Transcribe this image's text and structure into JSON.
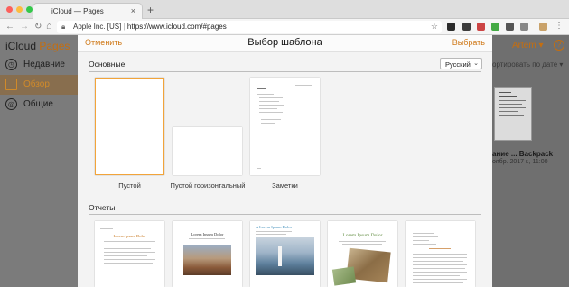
{
  "browser": {
    "tab_title": "iCloud — Pages",
    "tab_close": "×",
    "new_tab": "+",
    "url_site": "Apple Inc. [US]",
    "url_sep": "|",
    "url_text": "https://www.icloud.com/#pages"
  },
  "app": {
    "logo_prefix": "iCloud",
    "logo_app": "Pages",
    "nav": [
      {
        "label": "Недавние",
        "icon": "clock-icon"
      },
      {
        "label": "Обзор",
        "icon": "folder-icon",
        "selected": true
      },
      {
        "label": "Общие",
        "icon": "people-icon"
      }
    ],
    "user": "Artem ▾",
    "help": "?",
    "sort_label": "ортировать по дате ▾",
    "doc_name": "ание ... Backpack",
    "doc_date": "оябр. 2017 г., 11:00"
  },
  "modal": {
    "cancel": "Отменить",
    "title": "Выбор шаблона",
    "choose": "Выбрать",
    "language": "Русский",
    "sections": [
      {
        "title": "Основные",
        "templates": [
          "Пустой",
          "Пустой горизонтальный",
          "Заметки"
        ]
      },
      {
        "title": "Отчеты",
        "templates": [
          "",
          "",
          "",
          "",
          ""
        ]
      }
    ],
    "report_headlines": [
      "Lorem Ipsum Dolor",
      "Lorem Ipsum Dolor",
      "A Lorem Ipsum Dolor",
      "Lorem Ipsum Dolor",
      ""
    ]
  },
  "colors": {
    "accent": "#d07a1a",
    "selected_border": "#f2a43a"
  }
}
